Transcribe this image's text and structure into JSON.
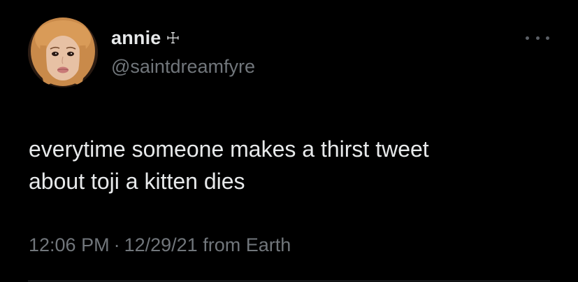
{
  "author": {
    "display_name": "annie",
    "name_glyph": "☩",
    "handle": "@saintdreamfyre"
  },
  "tweet": {
    "text_lines": [
      "everytime someone makes a thirst tweet",
      "about toji a kitten dies"
    ],
    "time": "12:06 PM",
    "separator": "·",
    "date": "12/29/21",
    "source": "from Earth"
  },
  "icons": {
    "more": "more-horizontal-icon",
    "avatar": "profile-photo"
  },
  "colors": {
    "background": "#000000",
    "primary_text": "#e7e9ea",
    "secondary_text": "#71767b",
    "divider": "#2f3336"
  }
}
